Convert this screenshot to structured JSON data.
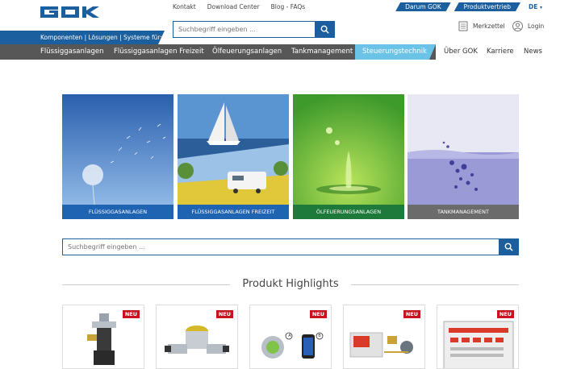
{
  "brand": {
    "logo_text": "GOK",
    "color": "#1c5f9e"
  },
  "top_links": [
    "Kontakt",
    "Download Center",
    "Blog - FAQs"
  ],
  "lang_tabs": [
    "Darum GOK",
    "Produktvertrieb"
  ],
  "language": "DE",
  "systems_label": "Komponenten | Lösungen | Systeme für:",
  "search_top": {
    "placeholder": "Suchbegriff eingeben ..."
  },
  "merkzettel": "Merkzettel",
  "login": "Login",
  "nav": [
    "Flüssiggasanlagen",
    "Flüssiggasanlagen Freizeit",
    "Ölfeuerungsanlagen",
    "Tankmanagement",
    "Steuerungstechnik",
    "Über GOK",
    "Karriere",
    "News"
  ],
  "tiles": [
    {
      "label": "FLÜSSIGGASANLAGEN",
      "color": "#1f63b3"
    },
    {
      "label": "FLÜSSIGGASANLAGEN FREIZEIT",
      "color": "#1f63b3"
    },
    {
      "label": "ÖLFEUERUNGSANLAGEN",
      "color": "#1e7a3a"
    },
    {
      "label": "TANKMANAGEMENT",
      "color": "#6b6b6b"
    }
  ],
  "search_main": {
    "placeholder": "Suchbegriff eingeben ..."
  },
  "highlights_title": "Produkt Highlights",
  "product_badges": [
    "NEU",
    "NEU",
    "NEU",
    "NEU",
    "NEU"
  ],
  "diagram_marks": [
    "A",
    "B"
  ]
}
